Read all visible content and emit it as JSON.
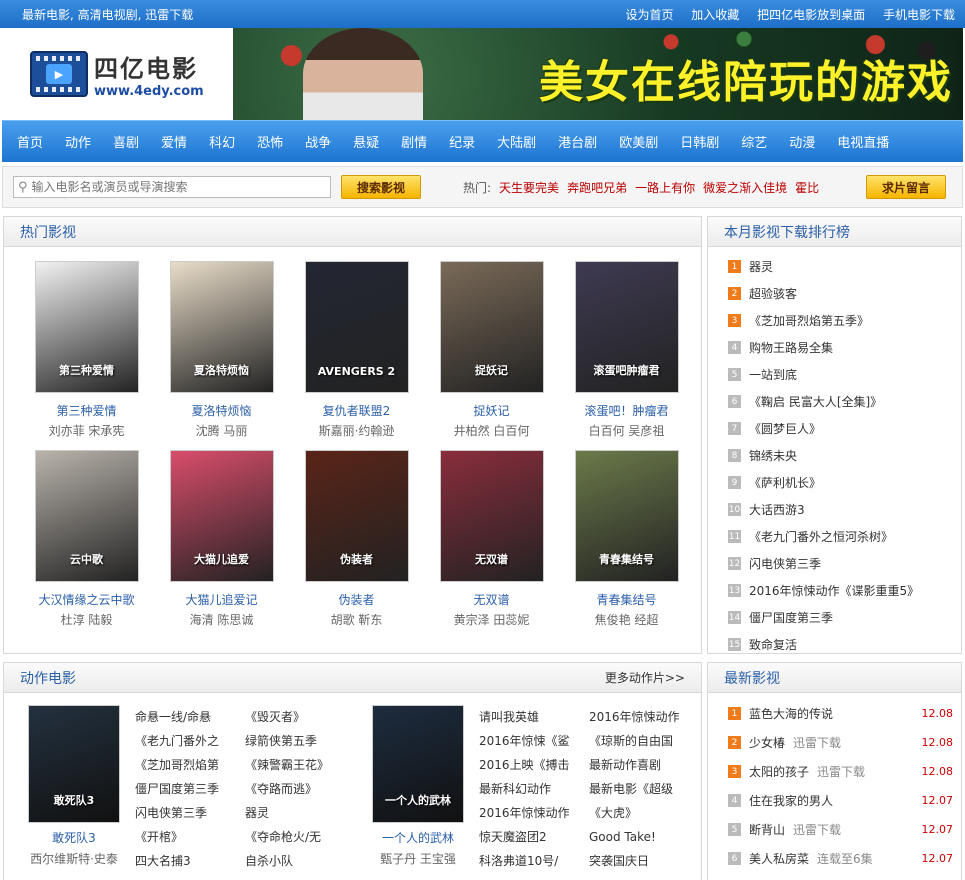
{
  "topbar": {
    "slogan": "最新电影, 高清电视剧, 迅雷下载",
    "links": [
      "设为首页",
      "加入收藏",
      "把四亿电影放到桌面",
      "手机电影下载"
    ]
  },
  "logo": {
    "name": "四亿电影",
    "url": "www.4edy.com"
  },
  "banner": {
    "text": "美女在线陪玩的游戏"
  },
  "nav": [
    "首页",
    "动作",
    "喜剧",
    "爱情",
    "科幻",
    "恐怖",
    "战争",
    "悬疑",
    "剧情",
    "纪录",
    "大陆剧",
    "港台剧",
    "欧美剧",
    "日韩剧",
    "综艺",
    "动漫",
    "电视直播"
  ],
  "search": {
    "placeholder": "输入电影名或演员或导演搜索",
    "button": "搜索影视",
    "hot_label": "热门:",
    "hot_keywords": [
      "天生要完美",
      "奔跑吧兄弟",
      "一路上有你",
      "微爱之渐入佳境",
      "霍比"
    ],
    "ask_button": "求片留言"
  },
  "hot_movies": {
    "title": "热门影视",
    "items": [
      {
        "title": "第三种爱情",
        "actors": "刘亦菲  宋承宪",
        "poster_text": "第三种爱情",
        "color": "#f2f2f2"
      },
      {
        "title": "夏洛特烦恼",
        "actors": "沈腾  马丽",
        "poster_text": "夏洛特烦恼",
        "color": "#e9ddc9"
      },
      {
        "title": "复仇者联盟2",
        "actors": "斯嘉丽·约翰逊",
        "poster_text": "AVENGERS 2",
        "color": "#232733"
      },
      {
        "title": "捉妖记",
        "actors": "井柏然  白百何",
        "poster_text": "捉妖记",
        "color": "#7a6a58"
      },
      {
        "title": "滚蛋吧！肿瘤君",
        "actors": "白百何  吴彦祖",
        "poster_text": "滚蛋吧肿瘤君",
        "color": "#3f3a52"
      },
      {
        "title": "大汉情缘之云中歌",
        "actors": "杜淳  陆毅",
        "poster_text": "云中歌",
        "color": "#b9b3ab"
      },
      {
        "title": "大猫儿追爱记",
        "actors": "海清  陈思诚",
        "poster_text": "大猫儿追爱",
        "color": "#d94d6b"
      },
      {
        "title": "伪装者",
        "actors": "胡歌  靳东",
        "poster_text": "伪装者",
        "color": "#5a2418"
      },
      {
        "title": "无双谱",
        "actors": "黄宗泽  田蕊妮",
        "poster_text": "无双谱",
        "color": "#8a2d3c"
      },
      {
        "title": "青春集结号",
        "actors": "焦俊艳  经超",
        "poster_text": "青春集结号",
        "color": "#6b7a4a"
      }
    ]
  },
  "rank": {
    "title": "本月影视下载排行榜",
    "items": [
      {
        "num": "1",
        "title": "器灵"
      },
      {
        "num": "2",
        "title": "超验骇客"
      },
      {
        "num": "3",
        "title": "《芝加哥烈焰第五季》"
      },
      {
        "num": "4",
        "title": "购物王路易全集"
      },
      {
        "num": "5",
        "title": "一站到底"
      },
      {
        "num": "6",
        "title": "《鞠启 民富大人[全集]》"
      },
      {
        "num": "7",
        "title": "《圆梦巨人》"
      },
      {
        "num": "8",
        "title": "锦绣未央"
      },
      {
        "num": "9",
        "title": "《萨利机长》"
      },
      {
        "num": "10",
        "title": "大话西游3"
      },
      {
        "num": "11",
        "title": "《老九门番外之恒河杀树》"
      },
      {
        "num": "12",
        "title": "闪电侠第三季"
      },
      {
        "num": "13",
        "title": "2016年惊悚动作《谍影重重5》"
      },
      {
        "num": "14",
        "title": "僵尸国度第三季"
      },
      {
        "num": "15",
        "title": "致命复活"
      }
    ]
  },
  "action": {
    "title": "动作电影",
    "more": "更多动作片>>",
    "feature1": {
      "title": "敢死队3",
      "actors": "西尔维斯特·史泰",
      "poster_text": "敢死队3",
      "color": "#23313f"
    },
    "feature2": {
      "title": "一个人的武林",
      "actors": "甄子丹  王宝强",
      "poster_text": "一个人的武林",
      "color": "#1d2c3f"
    },
    "col1": [
      "命悬一线/命悬",
      "《老九门番外之",
      "《芝加哥烈焰第",
      "僵尸国度第三季",
      "闪电侠第三季",
      "《开棺》",
      "四大名捕3"
    ],
    "col2": [
      "《毁灭者》",
      "绿箭侠第五季",
      "《辣警霸王花》",
      "《夺路而逃》",
      "器灵",
      "《夺命枪火/无",
      "自杀小队"
    ],
    "col3": [
      "请叫我英雄",
      "2016年惊悚《鲨",
      "2016上映《搏击",
      "最新科幻动作",
      "2016年惊悚动作",
      "惊天魔盗团2",
      "科洛弗道10号/"
    ],
    "col4": [
      "2016年惊悚动作",
      "《琼斯的自由国",
      "最新动作喜剧",
      "最新电影《超级",
      "《大虎》",
      "Good Take!",
      "突袭国庆日"
    ]
  },
  "latest": {
    "title": "最新影视",
    "items": [
      {
        "num": "1",
        "title": "蓝色大海的传说",
        "extra": "",
        "date": "12.08"
      },
      {
        "num": "2",
        "title": "少女椿",
        "extra": "迅雷下载",
        "date": "12.08"
      },
      {
        "num": "3",
        "title": "太阳的孩子",
        "extra": "迅雷下载",
        "date": "12.08"
      },
      {
        "num": "4",
        "title": "住在我家的男人",
        "extra": "",
        "date": "12.07"
      },
      {
        "num": "5",
        "title": "断背山",
        "extra": "迅雷下载",
        "date": "12.07"
      },
      {
        "num": "6",
        "title": "美人私房菜",
        "extra": "连载至6集",
        "date": "12.07"
      }
    ]
  }
}
